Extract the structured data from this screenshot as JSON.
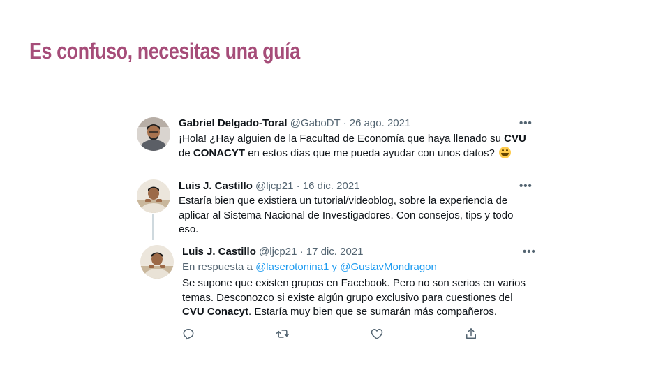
{
  "slide": {
    "title": "Es confuso, necesitas una guía"
  },
  "tweets": [
    {
      "name": "Gabriel Delgado-Toral",
      "meta": "@GaboDT · 26 ago. 2021",
      "more": "•••",
      "lines": [
        [
          "¡Hola! ¿Hay alguien de la Facultad de Economía que haya llenado su ",
          "CVU"
        ],
        [
          "de ",
          "CONACYT",
          " en estos días que me pueda ayudar con unos datos?"
        ]
      ],
      "emoji": "grinning-face-emoji"
    },
    {
      "name": "Luis J. Castillo",
      "meta": "@ljcp21 · 16 dic. 2021",
      "more": "•••",
      "lines": [
        "Estaría bien que existiera un tutorial/videoblog, sobre la experiencia de",
        "aplicar al Sistema Nacional de Investigadores. Con consejos, tips y todo",
        "eso."
      ]
    },
    {
      "name": "Luis J. Castillo",
      "meta": "@ljcp21 · 17 dic. 2021",
      "more": "•••",
      "reply_prefix": "En respuesta a ",
      "mention1": "@laserotonina1",
      "reply_and": " y ",
      "mention2": "@GustavMondragon",
      "lines": [
        "Se supone que existen grupos en Facebook. Pero no son serios en varios",
        "temas. Desconozco si existe algún grupo exclusivo para cuestiones del",
        [
          "CVU Conacyt",
          ". Estaría muy bien que se sumarán más compañeros."
        ]
      ]
    }
  ],
  "actions": [
    "reply-icon",
    "retweet-icon",
    "like-icon",
    "share-icon"
  ],
  "colors": {
    "title": "#a64d79",
    "mention": "#1d9bf0",
    "meta": "#536471",
    "thread_line": "#cfd9de"
  }
}
